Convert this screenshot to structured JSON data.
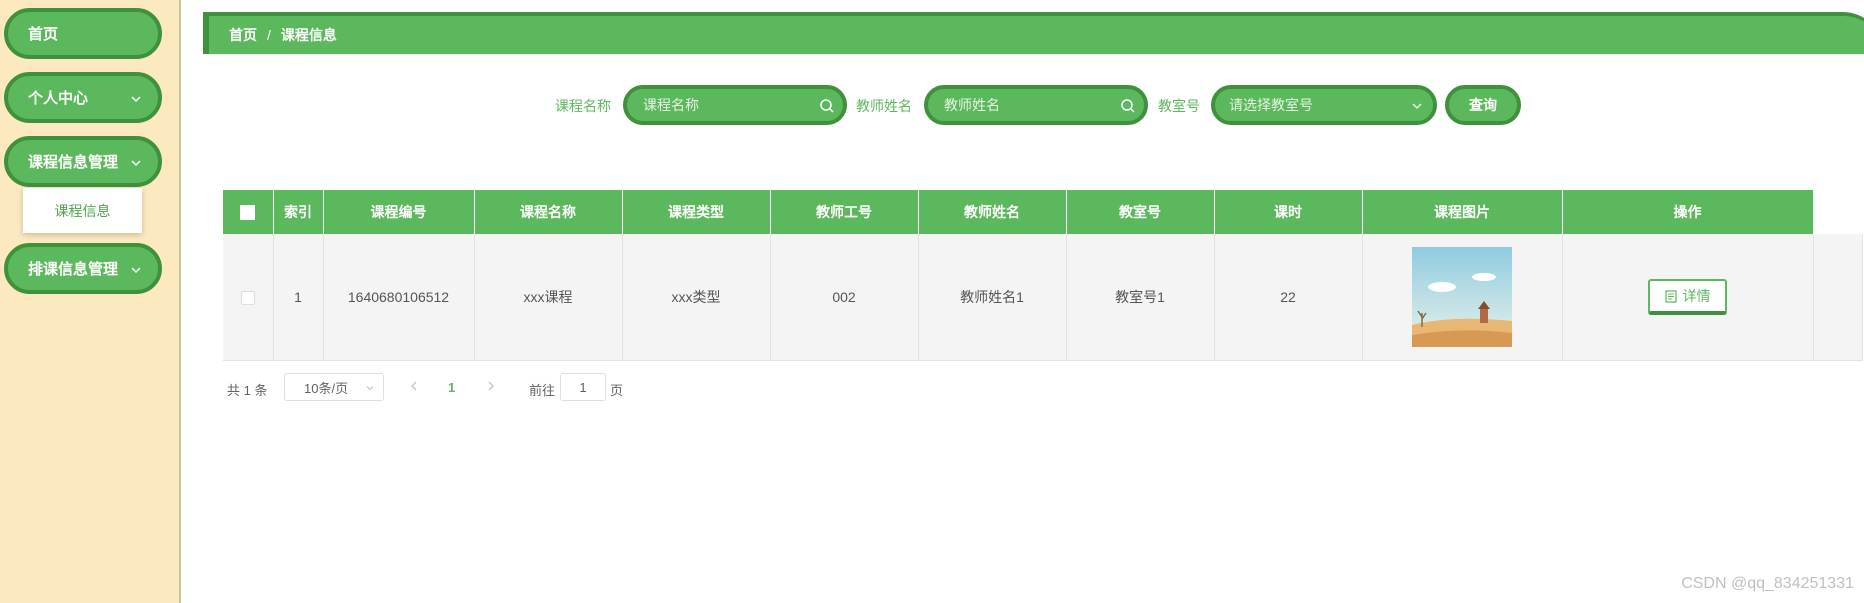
{
  "sidebar": {
    "items": [
      {
        "label": "首页",
        "has_chevron": false
      },
      {
        "label": "个人中心",
        "has_chevron": true
      },
      {
        "label": "课程信息管理",
        "has_chevron": true
      },
      {
        "label": "排课信息管理",
        "has_chevron": true
      }
    ],
    "submenu": {
      "label": "课程信息"
    }
  },
  "breadcrumb": {
    "home": "首页",
    "separator": "/",
    "current": "课程信息"
  },
  "search": {
    "course_name_label": "课程名称",
    "course_name_placeholder": "课程名称",
    "teacher_name_label": "教师姓名",
    "teacher_name_placeholder": "教师姓名",
    "classroom_label": "教室号",
    "classroom_placeholder": "请选择教室号",
    "query_button": "查询"
  },
  "table": {
    "columns": [
      "索引",
      "课程编号",
      "课程名称",
      "课程类型",
      "教师工号",
      "教师姓名",
      "教室号",
      "课时",
      "课程图片",
      "操作"
    ],
    "rows": [
      {
        "index": "1",
        "course_no": "1640680106512",
        "course_name": "xxx课程",
        "course_type": "xxx类型",
        "teacher_no": "002",
        "teacher_name": "教师姓名1",
        "classroom": "教室号1",
        "hours": "22",
        "image": "course-thumbnail",
        "action_label": "详情"
      }
    ]
  },
  "pagination": {
    "total_text": "共 1 条",
    "page_size": "10条/页",
    "current_page": "1",
    "goto_label": "前往",
    "goto_value": "1",
    "page_suffix": "页"
  },
  "watermark": "CSDN @qq_834251331",
  "colors": {
    "primary": "#5cb85c",
    "primary_dark": "#3f913c",
    "sidebar_bg": "#fde9bf"
  }
}
